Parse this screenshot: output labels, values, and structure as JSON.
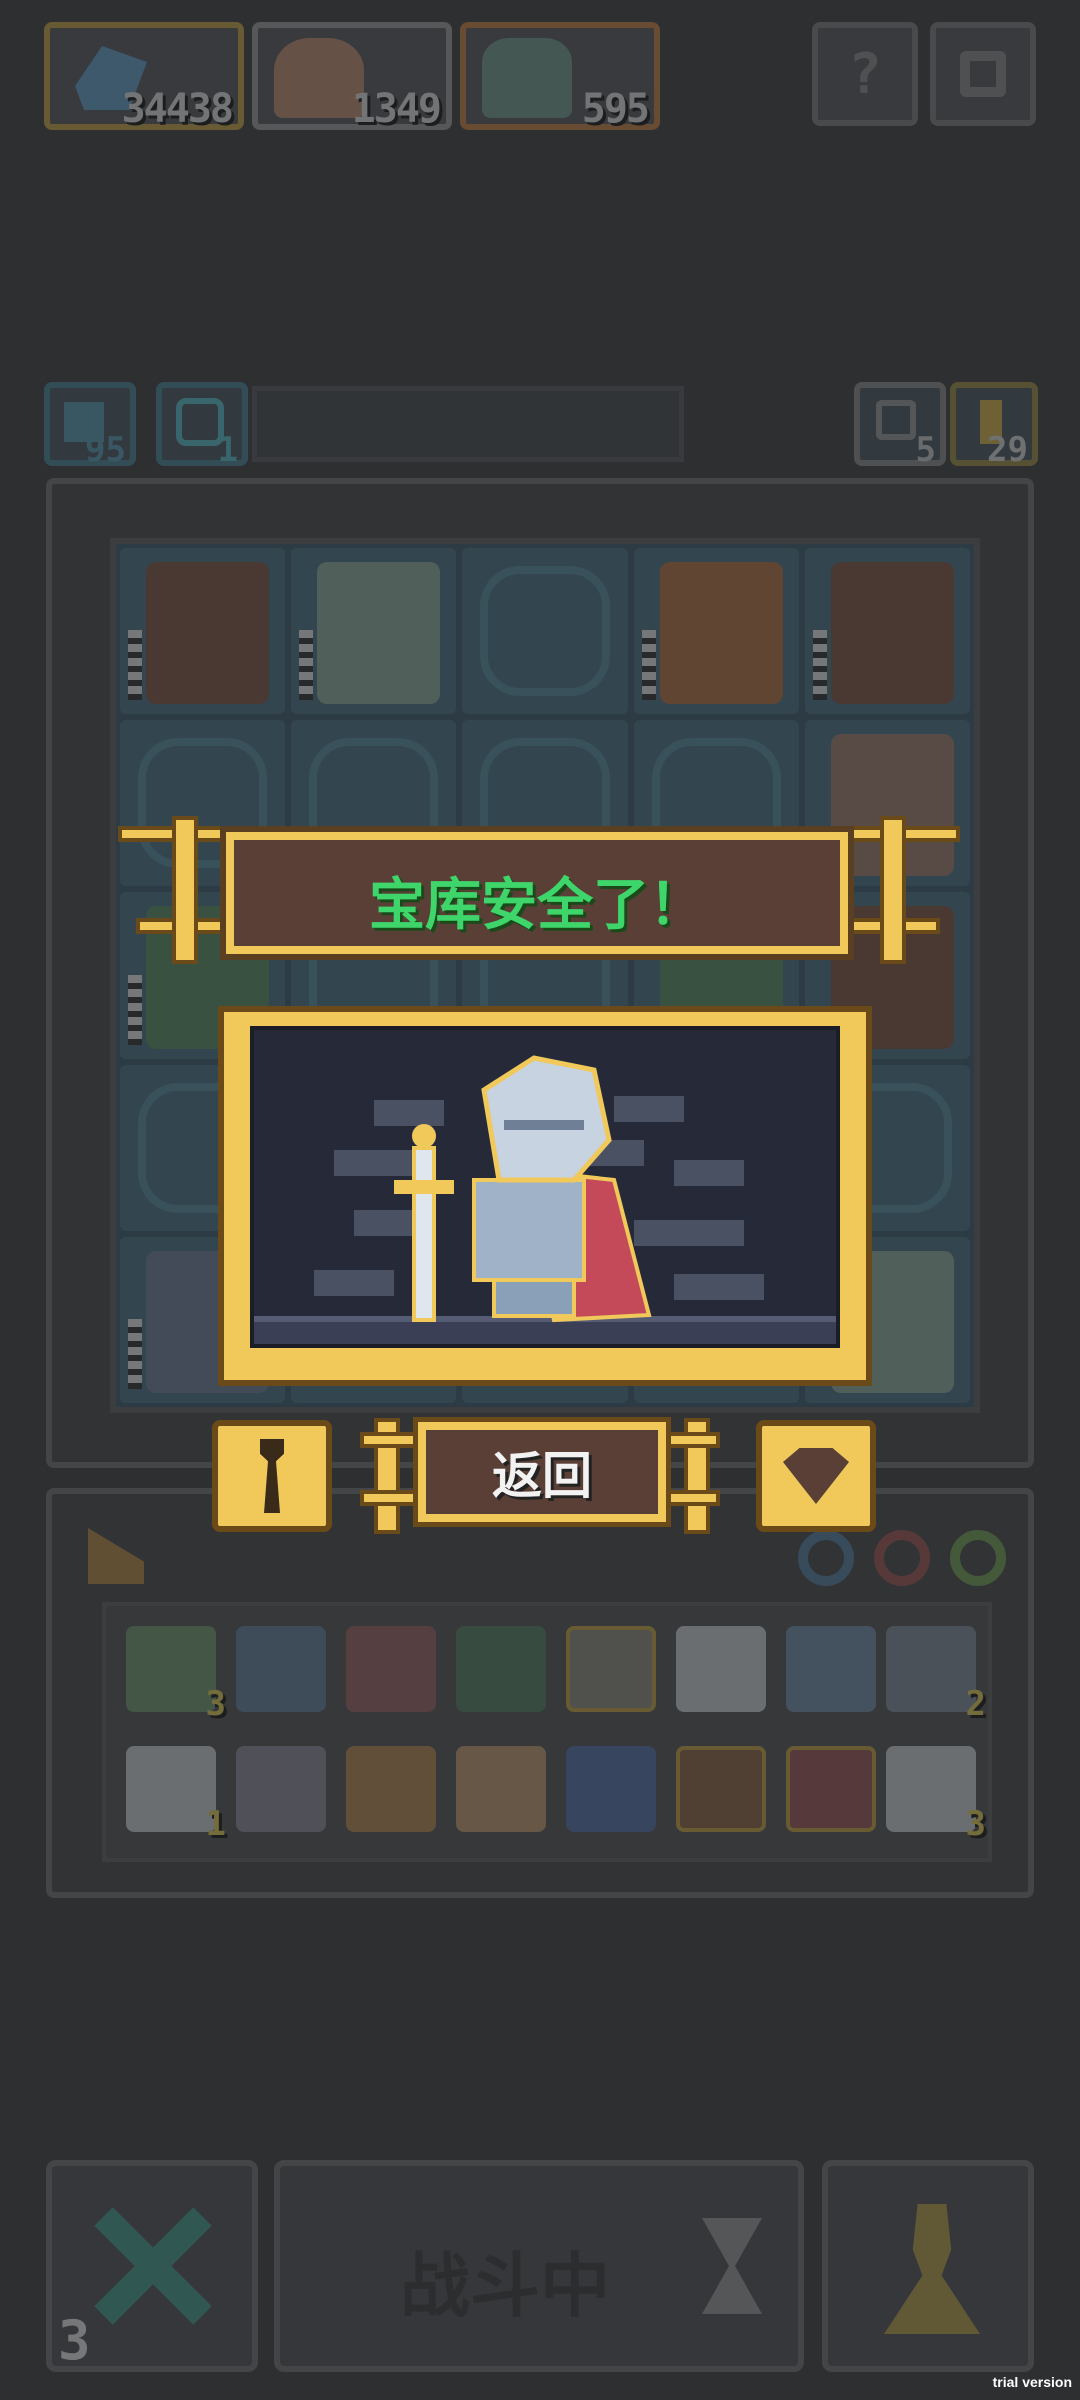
{
  "currencies": [
    {
      "name": "blue-crystal",
      "value": "34438",
      "border": "#c9a53a"
    },
    {
      "name": "meat",
      "value": "1349",
      "border": "#9a9a9a"
    },
    {
      "name": "hero",
      "value": "595",
      "border": "#c87a3a"
    }
  ],
  "top_buttons": {
    "help_label": "?"
  },
  "mini_counters": {
    "left_a": "95",
    "left_b": "1",
    "right_a": "5",
    "right_b": "29"
  },
  "dialog": {
    "title": "宝库安全了！",
    "back_label": "返回"
  },
  "inventory": {
    "quantities": [
      "3",
      "2",
      "1",
      "3"
    ]
  },
  "action_bar": {
    "fight_label": "战斗中",
    "cancel_count": "3"
  },
  "watermark": "trial version",
  "colors": {
    "accent_gold": "#f0c95a",
    "title_green": "#3ed66a",
    "plate_brown": "#5a3f36"
  }
}
